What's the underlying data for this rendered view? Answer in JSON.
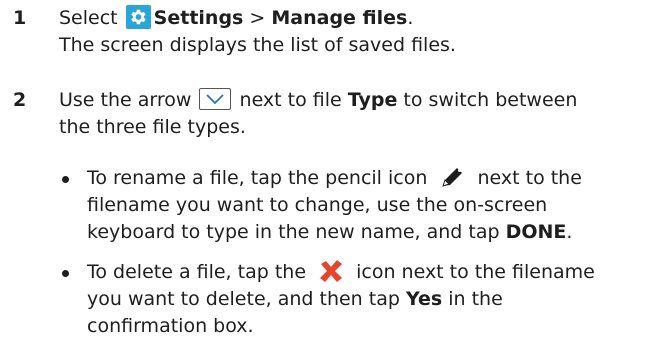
{
  "steps": [
    {
      "number": "1",
      "select_label": "Select",
      "settings_label": "Settings",
      "separator": ">",
      "manage_files_label": "Manage files",
      "period": ".",
      "description": "The screen displays the list of saved files."
    },
    {
      "number": "2",
      "line1_a": "Use the arrow",
      "line1_b": "next to file",
      "type_label": "Type",
      "line1_c": "to switch between",
      "line2": "the three file types."
    }
  ],
  "bullets": [
    {
      "line1_a": "To rename a file, tap the pencil icon",
      "line1_b": "next to the",
      "line2": "filename you want to change, use the on-screen",
      "line3_a": "keyboard to type in the new name, and tap",
      "done_label": "DONE",
      "period": "."
    },
    {
      "line1_a": "To delete a file, tap the",
      "line1_b": "icon next to the filename",
      "line2_a": "you want to delete, and then tap",
      "yes_label": "Yes",
      "line2_b": "in the",
      "line3": "confirmation box."
    }
  ],
  "icons": {
    "settings": "gear-icon",
    "dropdown_arrow": "chevron-down-icon",
    "rename": "pencil-icon",
    "delete": "x-icon"
  },
  "colors": {
    "settings_icon_bg": "#2aa6d6",
    "delete_icon": "#e8442c",
    "text": "#1e1e1e"
  }
}
